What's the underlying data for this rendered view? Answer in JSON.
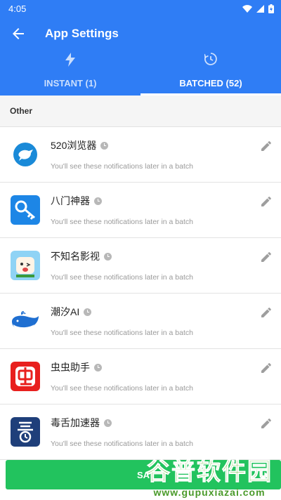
{
  "status_bar": {
    "time": "4:05"
  },
  "app_bar": {
    "title": "App Settings"
  },
  "tabs": [
    {
      "label": "INSTANT (1)",
      "icon": "bolt-icon",
      "active": false
    },
    {
      "label": "BATCHED (52)",
      "icon": "history-icon",
      "active": true
    }
  ],
  "section": {
    "title": "Other"
  },
  "apps": [
    {
      "name": "520浏览器",
      "subtitle": "You'll see these notifications later in a batch"
    },
    {
      "name": "八门神器",
      "subtitle": "You'll see these notifications later in a batch"
    },
    {
      "name": "不知名影视",
      "subtitle": "You'll see these notifications later in a batch"
    },
    {
      "name": "潮汐AI",
      "subtitle": "You'll see these notifications later in a batch"
    },
    {
      "name": "虫虫助手",
      "subtitle": "You'll see these notifications later in a batch"
    },
    {
      "name": "毒舌加速器",
      "subtitle": "You'll see these notifications later in a batch"
    }
  ],
  "save_button": {
    "label": "SA"
  },
  "watermark": {
    "title": "谷普软件园",
    "url": "www.gupuxiazai.com"
  },
  "colors": {
    "primary": "#2f7df5",
    "save": "#22c35e"
  }
}
